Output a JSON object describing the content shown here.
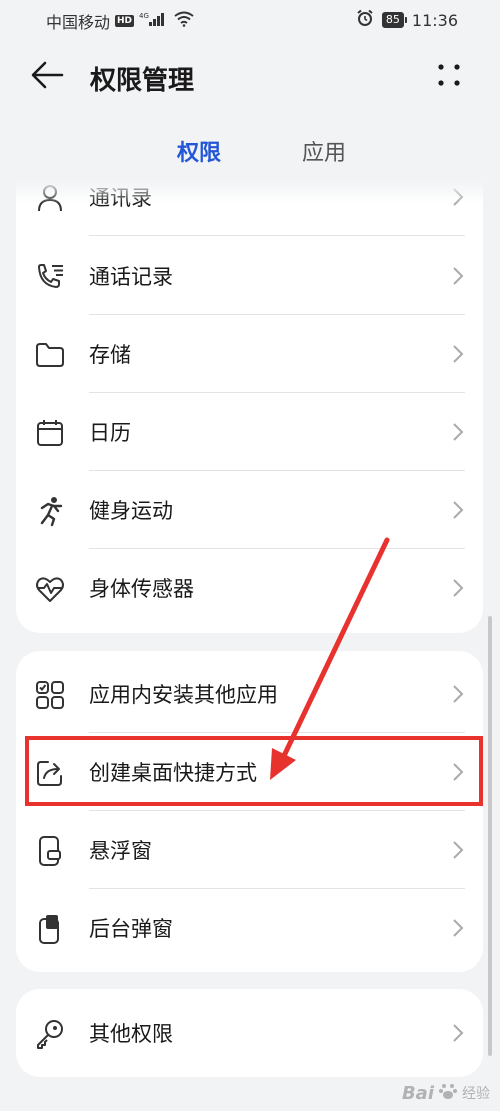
{
  "status_bar": {
    "carrier": "中国移动",
    "hd": "HD",
    "network": "4G",
    "battery": "85",
    "time": "11:36"
  },
  "header": {
    "title": "权限管理"
  },
  "tabs": [
    {
      "label": "权限",
      "active": true
    },
    {
      "label": "应用",
      "active": false
    }
  ],
  "group1": {
    "items": [
      {
        "label": "通讯录",
        "icon": "contacts-icon"
      },
      {
        "label": "通话记录",
        "icon": "call-log-icon"
      },
      {
        "label": "存储",
        "icon": "folder-icon"
      },
      {
        "label": "日历",
        "icon": "calendar-icon"
      },
      {
        "label": "健身运动",
        "icon": "running-icon"
      },
      {
        "label": "身体传感器",
        "icon": "heart-rate-icon"
      }
    ]
  },
  "group2": {
    "items": [
      {
        "label": "应用内安装其他应用",
        "icon": "apps-grid-icon"
      },
      {
        "label": "创建桌面快捷方式",
        "icon": "shortcut-share-icon"
      },
      {
        "label": "悬浮窗",
        "icon": "floating-window-icon"
      },
      {
        "label": "后台弹窗",
        "icon": "background-popup-icon"
      }
    ]
  },
  "group3": {
    "items": [
      {
        "label": "其他权限",
        "icon": "key-icon"
      }
    ]
  },
  "annotation": {
    "color": "#e8322e"
  },
  "watermark": {
    "text": "Bai",
    "suffix": "经验"
  },
  "colors": {
    "accent": "#2457d6",
    "background": "#f1f3f5",
    "card": "#ffffff"
  }
}
